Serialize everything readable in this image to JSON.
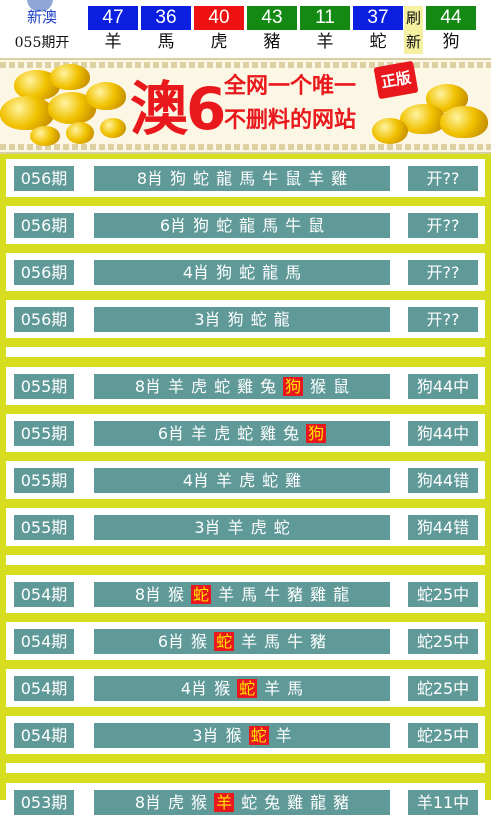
{
  "header": {
    "brand": "新澳",
    "issue": "055期开",
    "refresh": [
      "刷",
      "新"
    ],
    "balls": [
      {
        "num": "47",
        "zodiac": "羊",
        "color": "blue"
      },
      {
        "num": "36",
        "zodiac": "馬",
        "color": "blue"
      },
      {
        "num": "40",
        "zodiac": "虎",
        "color": "red"
      },
      {
        "num": "43",
        "zodiac": "豬",
        "color": "green"
      },
      {
        "num": "11",
        "zodiac": "羊",
        "color": "green"
      },
      {
        "num": "37",
        "zodiac": "蛇",
        "color": "blue"
      },
      {
        "num": "44",
        "zodiac": "狗",
        "color": "green"
      }
    ]
  },
  "banner": {
    "logo": "澳6",
    "slogan_line1": "全网一个唯一",
    "slogan_line2": "不删料的网站",
    "stamp": "正版"
  },
  "rows": [
    {
      "period": "056期",
      "prefix": "8肖",
      "zodiacs": [
        "狗",
        "蛇",
        "龍",
        "馬",
        "牛",
        "鼠",
        "羊",
        "雞"
      ],
      "hit": "",
      "result": "开??"
    },
    {
      "period": "056期",
      "prefix": "6肖",
      "zodiacs": [
        "狗",
        "蛇",
        "龍",
        "馬",
        "牛",
        "鼠"
      ],
      "hit": "",
      "result": "开??"
    },
    {
      "period": "056期",
      "prefix": "4肖",
      "zodiacs": [
        "狗",
        "蛇",
        "龍",
        "馬"
      ],
      "hit": "",
      "result": "开??"
    },
    {
      "period": "056期",
      "prefix": "3肖",
      "zodiacs": [
        "狗",
        "蛇",
        "龍"
      ],
      "hit": "",
      "result": "开??"
    },
    {
      "period": "055期",
      "prefix": "8肖",
      "zodiacs": [
        "羊",
        "虎",
        "蛇",
        "雞",
        "兔",
        "狗",
        "猴",
        "鼠"
      ],
      "hit": "狗",
      "result": "狗44中"
    },
    {
      "period": "055期",
      "prefix": "6肖",
      "zodiacs": [
        "羊",
        "虎",
        "蛇",
        "雞",
        "兔",
        "狗"
      ],
      "hit": "狗",
      "result": "狗44中"
    },
    {
      "period": "055期",
      "prefix": "4肖",
      "zodiacs": [
        "羊",
        "虎",
        "蛇",
        "雞"
      ],
      "hit": "",
      "result": "狗44错"
    },
    {
      "period": "055期",
      "prefix": "3肖",
      "zodiacs": [
        "羊",
        "虎",
        "蛇"
      ],
      "hit": "",
      "result": "狗44错"
    },
    {
      "period": "054期",
      "prefix": "8肖",
      "zodiacs": [
        "猴",
        "蛇",
        "羊",
        "馬",
        "牛",
        "豬",
        "雞",
        "龍"
      ],
      "hit": "蛇",
      "result": "蛇25中"
    },
    {
      "period": "054期",
      "prefix": "6肖",
      "zodiacs": [
        "猴",
        "蛇",
        "羊",
        "馬",
        "牛",
        "豬"
      ],
      "hit": "蛇",
      "result": "蛇25中"
    },
    {
      "period": "054期",
      "prefix": "4肖",
      "zodiacs": [
        "猴",
        "蛇",
        "羊",
        "馬"
      ],
      "hit": "蛇",
      "result": "蛇25中"
    },
    {
      "period": "054期",
      "prefix": "3肖",
      "zodiacs": [
        "猴",
        "蛇",
        "羊"
      ],
      "hit": "蛇",
      "result": "蛇25中"
    },
    {
      "period": "053期",
      "prefix": "8肖",
      "zodiacs": [
        "虎",
        "猴",
        "羊",
        "蛇",
        "兔",
        "雞",
        "龍",
        "豬"
      ],
      "hit": "羊",
      "result": "羊11中"
    }
  ]
}
